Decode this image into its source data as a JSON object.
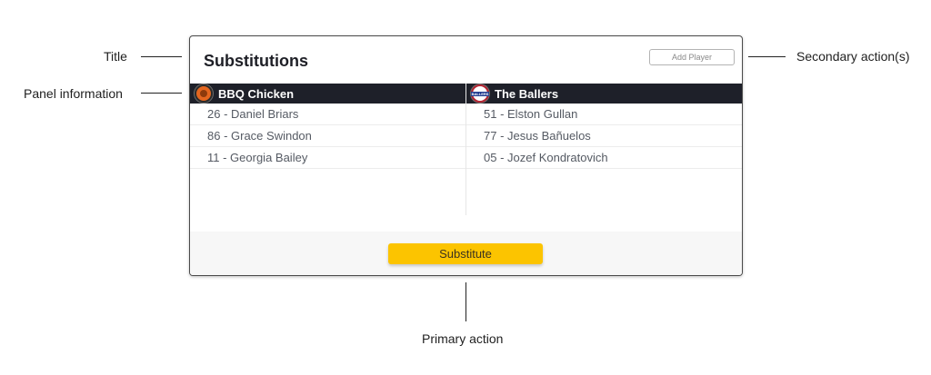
{
  "annotations": {
    "title": "Title",
    "panel_information": "Panel information",
    "secondary_actions": "Secondary action(s)",
    "primary_action": "Primary action"
  },
  "modal": {
    "title": "Substitutions",
    "secondary_button": "Add Player",
    "primary_button": "Substitute"
  },
  "teams": [
    {
      "name": "BBQ Chicken",
      "logo_icon": "bbq-chicken-logo-icon",
      "logo_color": "#e4661f",
      "players": [
        "26 - Daniel Briars",
        "86 - Grace Swindon",
        "11 - Georgia Bailey"
      ]
    },
    {
      "name": "The Ballers",
      "logo_icon": "the-ballers-logo-icon",
      "logo_color": "#b32432",
      "logo_text": "BALLERS",
      "players": [
        "51 - Elston Gullan",
        "77 - Jesus Bañuelos",
        "05 - Jozef Kondratovich"
      ]
    }
  ],
  "colors": {
    "header_bg": "#1e2029",
    "primary_button": "#fcc400",
    "footer_bg": "#f7f7f7"
  }
}
